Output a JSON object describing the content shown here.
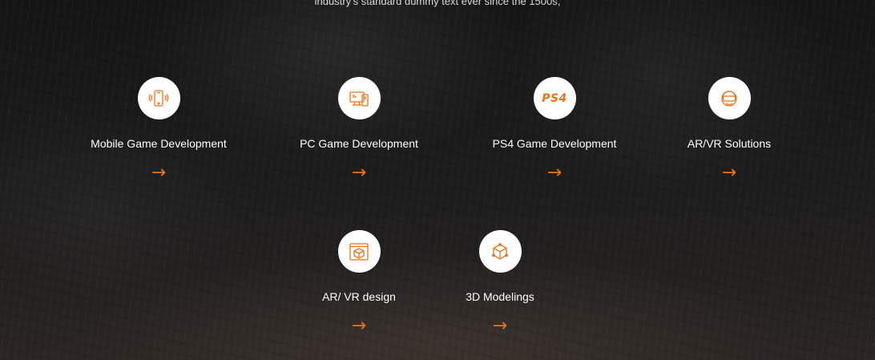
{
  "intro_text": "industry's standard dummy text ever since the 1500s,",
  "accent_color": "#e8741c",
  "services": [
    {
      "title": "Mobile Game Development",
      "icon": "mobile-icon",
      "arrow": "→"
    },
    {
      "title": "PC Game Development",
      "icon": "desktop-icon",
      "arrow": "→"
    },
    {
      "title": "PS4 Game Development",
      "icon": "ps4-icon",
      "icon_text": "PS4",
      "arrow": "→"
    },
    {
      "title": "AR/VR Solutions",
      "icon": "vr-headset-icon",
      "arrow": "→"
    },
    {
      "title": "AR/ VR design",
      "icon": "ar-vr-design-icon",
      "arrow": "→"
    },
    {
      "title": "3D Modelings",
      "icon": "3d-model-icon",
      "arrow": "→"
    }
  ]
}
